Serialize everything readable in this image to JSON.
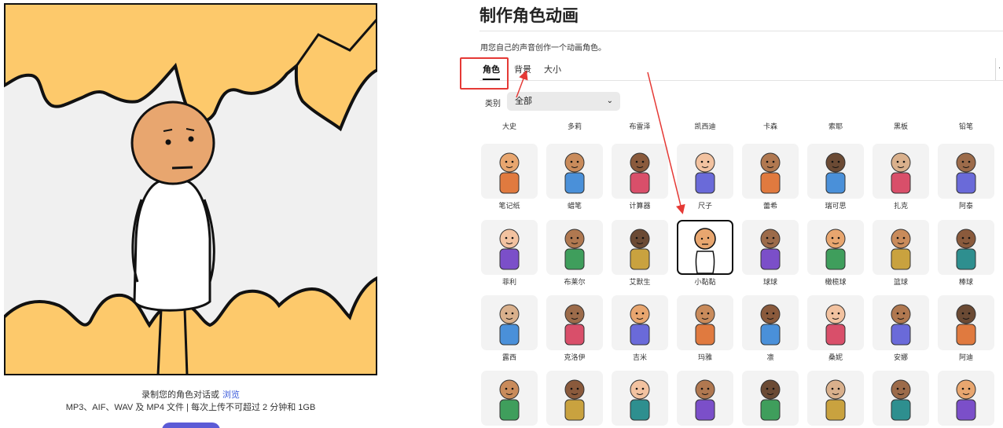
{
  "preview": {
    "upload_text": "录制您的角色对话或",
    "browse_label": "浏览",
    "formats_text": "MP3、AIF、WAV 及 MP4 文件 | 每次上传不可超过 2 分钟和 1GB"
  },
  "panel": {
    "title": "制作角色动画",
    "subtitle": "用您自己的声音创作一个动画角色。",
    "tabs": [
      "角色",
      "背景",
      "大小"
    ],
    "active_tab": "角色",
    "category_label": "类别",
    "category_value": "全部"
  },
  "characters": {
    "top_row": [
      "大史",
      "多莉",
      "布雷泽",
      "凯西迪",
      "卡森",
      "索耶",
      "黑板",
      "铅笔"
    ],
    "rows": [
      [
        "笔记纸",
        "蜡笔",
        "计算器",
        "尺子",
        "蕾希",
        "瑞可思",
        "扎克",
        "阿泰"
      ],
      [
        "菲利",
        "布莱尔",
        "艾默生",
        "小黏黏",
        "球球",
        "橄榄球",
        "篮球",
        "棒球"
      ],
      [
        "露西",
        "克洛伊",
        "吉米",
        "玛雅",
        "凛",
        "桑妮",
        "安娜",
        "阿迪"
      ],
      [
        "",
        "",
        "",
        "",
        "",
        "",
        "",
        ""
      ]
    ],
    "selected": "小黏黏"
  },
  "colors": {
    "accent_red": "#e53935",
    "cloud_yellow": "#fdc96b",
    "button_purple": "#5b5bd6"
  }
}
